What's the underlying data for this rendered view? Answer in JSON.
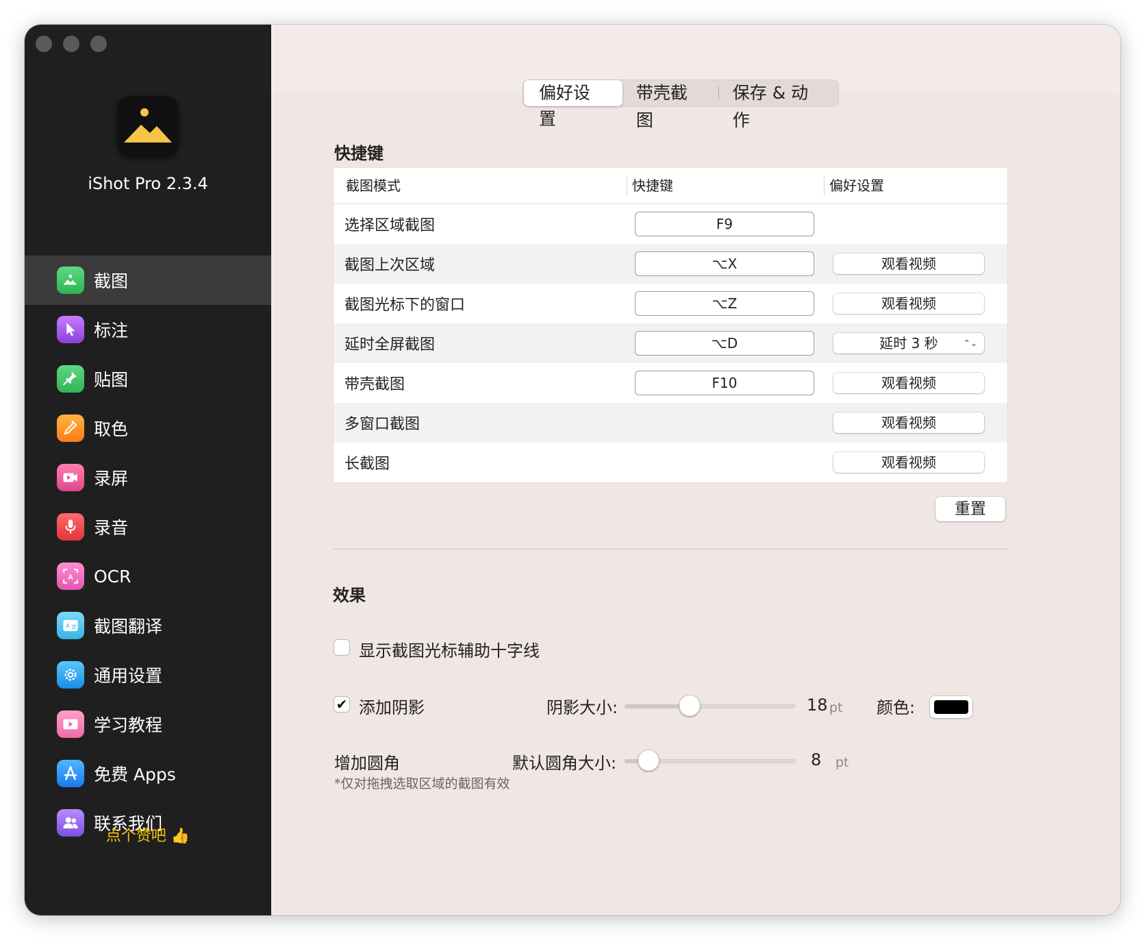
{
  "app": {
    "name": "iShot Pro 2.3.4"
  },
  "sidebar": {
    "items": [
      {
        "label": "截图",
        "icon": "landscape-icon",
        "color1": "#5fd883",
        "color2": "#2fb553",
        "active": true
      },
      {
        "label": "标注",
        "icon": "pointer-icon",
        "color1": "#c77dff",
        "color2": "#8b3fd9"
      },
      {
        "label": "贴图",
        "icon": "pin-icon",
        "color1": "#5fd883",
        "color2": "#2fb553"
      },
      {
        "label": "取色",
        "icon": "eyedropper-icon",
        "color1": "#ffb340",
        "color2": "#ff7a1a"
      },
      {
        "label": "录屏",
        "icon": "video-camera-icon",
        "color1": "#ff7fb0",
        "color2": "#e0458a"
      },
      {
        "label": "录音",
        "icon": "microphone-icon",
        "color1": "#ff6b6b",
        "color2": "#e0353a"
      },
      {
        "label": "OCR",
        "icon": "ocr-scan-icon",
        "color1": "#ff8fd0",
        "color2": "#e455b0"
      },
      {
        "label": "截图翻译",
        "icon": "translate-icon",
        "color1": "#7fd9f5",
        "color2": "#36b4e6"
      },
      {
        "label": "通用设置",
        "icon": "gear-icon",
        "color1": "#5ac8fa",
        "color2": "#1a8ce8"
      },
      {
        "label": "学习教程",
        "icon": "film-icon",
        "color1": "#ff9ec9",
        "color2": "#f06aa8"
      },
      {
        "label": "免费 Apps",
        "icon": "app-store-icon",
        "color1": "#4fb8ff",
        "color2": "#1a78f2"
      },
      {
        "label": "联系我们",
        "icon": "people-icon",
        "color1": "#b98cff",
        "color2": "#7d4fe0"
      }
    ],
    "like_label": "点个赞吧 👍"
  },
  "tabs": [
    "偏好设置",
    "带壳截图",
    "保存 & 动作"
  ],
  "shortcuts": {
    "title": "快捷键",
    "headers": [
      "截图模式",
      "快捷键",
      "偏好设置"
    ],
    "rows": [
      {
        "mode": "选择区域截图",
        "key": "F9",
        "pref": ""
      },
      {
        "mode": "截图上次区域",
        "key": "⌥X",
        "pref": "观看视频"
      },
      {
        "mode": "截图光标下的窗口",
        "key": "⌥Z",
        "pref": "观看视频"
      },
      {
        "mode": "延时全屏截图",
        "key": "⌥D",
        "pref": "延时 3 秒",
        "pref_type": "select"
      },
      {
        "mode": "带壳截图",
        "key": "F10",
        "pref": "观看视频"
      },
      {
        "mode": "多窗口截图",
        "key": "",
        "pref": "观看视频"
      },
      {
        "mode": "长截图",
        "key": "",
        "pref": "观看视频"
      }
    ],
    "reset_label": "重置"
  },
  "effects": {
    "title": "效果",
    "crosshair_label": "显示截图光标辅助十字线",
    "crosshair_checked": false,
    "shadow_label": "添加阴影",
    "shadow_checked": true,
    "shadow_size_label": "阴影大小:",
    "shadow_size_value": "18",
    "shadow_size_fraction": 0.38,
    "shadow_unit": "pt",
    "color_label": "颜色:",
    "shadow_color": "#000000",
    "corner_label": "增加圆角",
    "corner_note": "*仅对拖拽选取区域的截图有效",
    "corner_size_label": "默认圆角大小:",
    "corner_size_value": "8",
    "corner_size_fraction": 0.08,
    "corner_unit": "pt"
  }
}
